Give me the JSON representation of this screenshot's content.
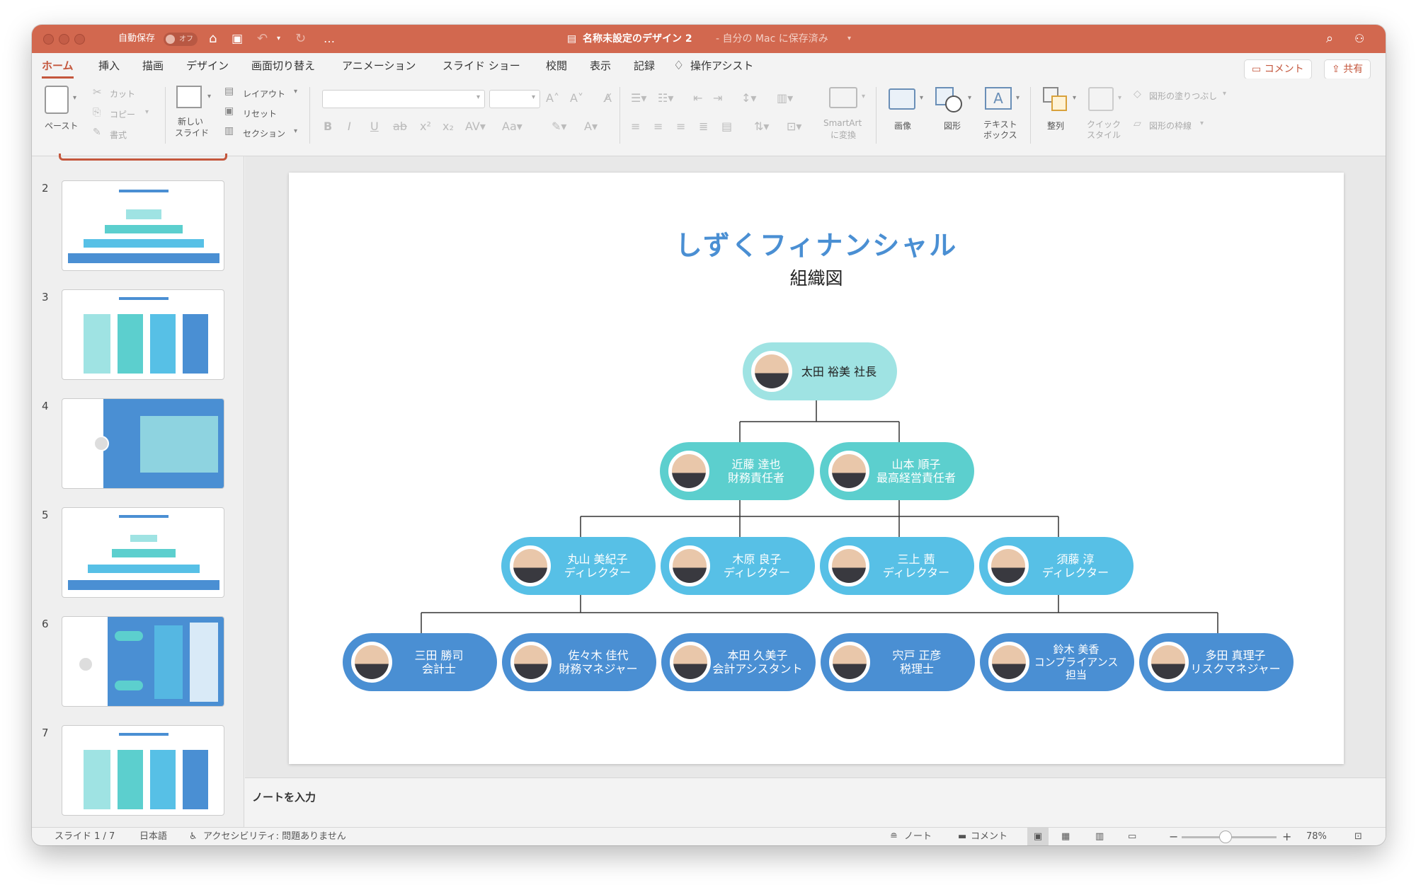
{
  "app": {
    "autosave_label": "自動保存",
    "autosave_state": "オフ",
    "doc_title": "名称未設定のデザイン 2",
    "doc_subtitle": "- 自分の Mac に保存済み",
    "more_label": "…"
  },
  "ribbon_tabs": [
    "ホーム",
    "挿入",
    "描画",
    "デザイン",
    "画面切り替え",
    "アニメーション",
    "スライド ショー",
    "校閲",
    "表示",
    "記録"
  ],
  "assist_label": "操作アシスト",
  "top_buttons": {
    "comment": "コメント",
    "share": "共有"
  },
  "ribbon": {
    "paste": "ペースト",
    "cut": "カット",
    "copy": "コピー",
    "format": "書式",
    "new_slide_1": "新しい",
    "new_slide_2": "スライド",
    "layout": "レイアウト",
    "reset": "リセット",
    "section": "セクション",
    "smartart_1": "SmartArt",
    "smartart_2": "に変換",
    "image": "画像",
    "shapes": "図形",
    "textbox_1": "テキスト",
    "textbox_2": "ボックス",
    "arrange": "整列",
    "quick_style_1": "クイック",
    "quick_style_2": "スタイル",
    "shape_fill": "図形の塗りつぶし",
    "shape_outline": "図形の枠線"
  },
  "thumbnails": [
    {
      "num": "2"
    },
    {
      "num": "3"
    },
    {
      "num": "4"
    },
    {
      "num": "5"
    },
    {
      "num": "6"
    },
    {
      "num": "7"
    }
  ],
  "slide": {
    "title": "しずくフィナンシャル",
    "subtitle": "組織図",
    "nodes": {
      "ceo": {
        "line1": "太田 裕美 社長"
      },
      "cfo": {
        "line1": "近藤 達也",
        "line2": "財務責任者"
      },
      "coo": {
        "line1": "山本 順子",
        "line2": "最高経営責任者"
      },
      "d1": {
        "line1": "丸山 美紀子",
        "line2": "ディレクター"
      },
      "d2": {
        "line1": "木原 良子",
        "line2": "ディレクター"
      },
      "d3": {
        "line1": "三上 茜",
        "line2": "ディレクター"
      },
      "d4": {
        "line1": "須藤 淳",
        "line2": "ディレクター"
      },
      "s1": {
        "line1": "三田 勝司",
        "line2": "会計士"
      },
      "s2": {
        "line1": "佐々木 佳代",
        "line2": "財務マネジャー"
      },
      "s3": {
        "line1": "本田 久美子",
        "line2": "会計アシスタント"
      },
      "s4": {
        "line1": "宍戸 正彦",
        "line2": "税理士"
      },
      "s5": {
        "line1": "鈴木 美香",
        "line2": "コンプライアンス",
        "line3": "担当"
      },
      "s6": {
        "line1": "多田 真理子",
        "line2": "リスクマネジャー"
      }
    }
  },
  "notes_placeholder": "ノートを入力",
  "status": {
    "slide_count": "スライド 1 / 7",
    "language": "日本語",
    "accessibility": "アクセシビリティ: 問題ありません",
    "notes": "ノート",
    "comments": "コメント",
    "zoom": "78%"
  },
  "colors": {
    "titlebar": "#d2684f",
    "accent": "#c4573d",
    "level1": "#9fe3e3",
    "level2": "#5ccfce",
    "level3": "#57c0e6",
    "level4": "#4a8fd3",
    "title_blue": "#4a8fd3"
  }
}
